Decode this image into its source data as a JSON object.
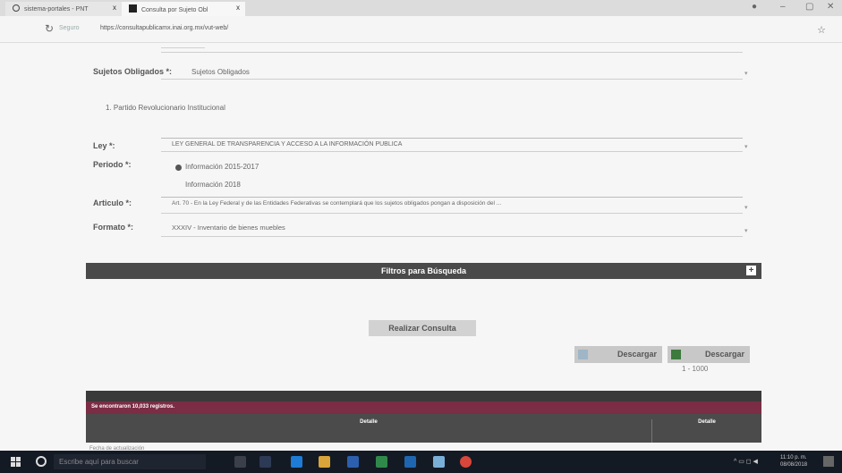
{
  "browser": {
    "tab1_title": "sistema-portales - PNT",
    "tab2_title": "Consulta por Sujeto Obl",
    "tab_close": "x",
    "url": "https://consultapublicamx.inai.org.mx/vut-web/",
    "secure_label": "Seguro"
  },
  "form": {
    "sujetos_label": "Sujetos Obligados *:",
    "sujetos_value": "Sujetos Obligados",
    "partido_text": "1. Partido Revolucionario Institucional",
    "ley_label": "Ley *:",
    "ley_value": "LEY GENERAL DE TRANSPARENCIA Y ACCESO A LA INFORMACIÓN PUBLICA",
    "periodo_label": "Periodo *:",
    "periodo_opt1": "Información 2015-2017",
    "periodo_opt2": "Información 2018",
    "articulo_label": "Articulo *:",
    "articulo_value": "Art. 70 - En la Ley Federal y de las Entidades Federativas se contemplará que los sujetos obligados pongan a disposición del ...",
    "formato_label": "Formato *:",
    "formato_value": "XXXIV - Inventario de bienes muebles"
  },
  "filters": {
    "title": "Filtros para Búsqueda",
    "expand": "+"
  },
  "actions": {
    "consulta": "Realizar Consulta",
    "descargar1": "Descargar",
    "descargar2": "Descargar",
    "page_size": "1 - 1000"
  },
  "results": {
    "count_text": "Se encontraron 10,033 registros.",
    "col_detalle": "Detalle",
    "col_detalle2": "Detalle",
    "footnote": "Fecha de actualización"
  },
  "taskbar": {
    "search_placeholder": "Escribe aquí para buscar",
    "time": "11:10 p. m.",
    "date": "08/08/2018"
  }
}
